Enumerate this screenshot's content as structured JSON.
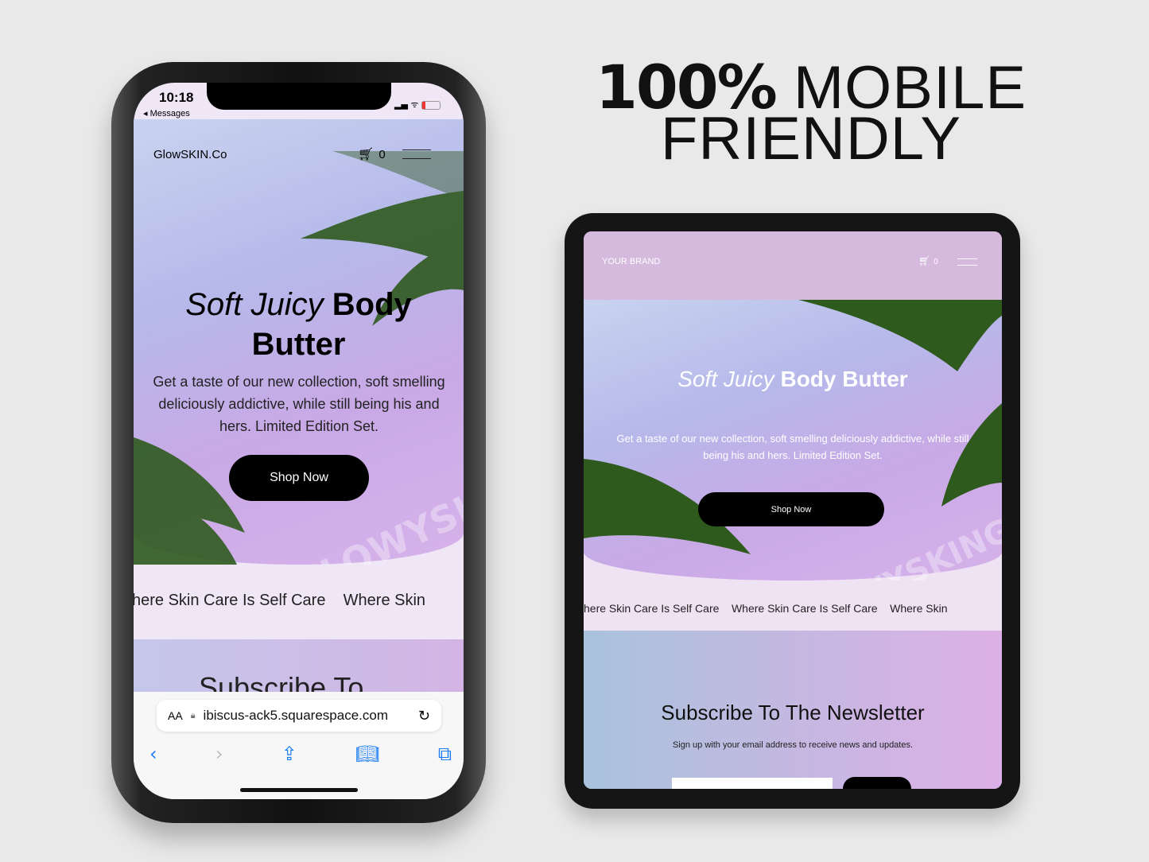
{
  "headline": {
    "line1_bold": "100%",
    "line1_rest": "MOBILE",
    "line2": "FRIENDLY"
  },
  "phone": {
    "status": {
      "time": "10:18",
      "back": "◂ Messages"
    },
    "brand": "GlowSKIN.Co",
    "cart_count": "0",
    "hero": {
      "title_italic": "Soft Juicy",
      "title_bold_1": "Body",
      "title_bold_2": "Butter",
      "body": "Get a taste of our new collection, soft smelling deliciously addictive, while still being his and hers. Limited Edition Set.",
      "button": "Shop Now",
      "watermark": "LOWYSKIN"
    },
    "marquee": "here Skin Care Is Self Care    Where Skin",
    "subscribe": "Subscribe To",
    "safari": {
      "aa": "AA",
      "url": "ibiscus-ack5.squarespace.com"
    }
  },
  "tablet": {
    "brand": "YOUR BRAND",
    "cart_count": "0",
    "hero": {
      "title_italic": "Soft Juicy",
      "title_bold": "Body Butter",
      "body": "Get a taste of our new collection, soft smelling deliciously addictive, while still being his and hers. Limited Edition Set.",
      "button": "Shop Now",
      "watermark": "OWYSKINGLOW"
    },
    "marquee": "here Skin Care Is Self Care    Where Skin Care Is Self Care    Where Skin",
    "subscribe": {
      "title": "Subscribe To The Newsletter",
      "subtitle": "Sign up with your email address to receive news and updates."
    }
  }
}
